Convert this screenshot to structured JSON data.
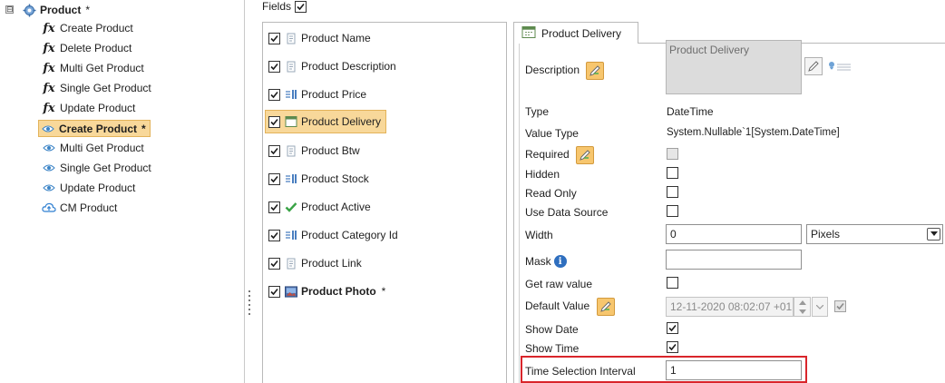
{
  "tree": {
    "root_label": "Product",
    "root_star": "*",
    "expander": "⊟",
    "items": [
      {
        "label": "Create Product",
        "icon": "fx"
      },
      {
        "label": "Delete Product",
        "icon": "fx"
      },
      {
        "label": "Multi Get Product",
        "icon": "fx"
      },
      {
        "label": "Single Get Product",
        "icon": "fx"
      },
      {
        "label": "Update Product",
        "icon": "fx"
      },
      {
        "label": "Create Product",
        "icon": "eye",
        "star": "*"
      },
      {
        "label": "Multi Get Product",
        "icon": "eye"
      },
      {
        "label": "Single Get Product",
        "icon": "eye"
      },
      {
        "label": "Update Product",
        "icon": "eye"
      },
      {
        "label": "CM Product",
        "icon": "cloud"
      }
    ]
  },
  "fields_header": {
    "label": "Fields",
    "checked": true
  },
  "fields": [
    {
      "label": "Product Name",
      "checked": true,
      "icon": "text-field-icon"
    },
    {
      "label": "Product Description",
      "checked": true,
      "icon": "text-field-icon"
    },
    {
      "label": "Product Price",
      "checked": true,
      "icon": "number-field-icon"
    },
    {
      "label": "Product Delivery",
      "checked": true,
      "icon": "calendar-icon"
    },
    {
      "label": "Product Btw",
      "checked": true,
      "icon": "text-field-icon"
    },
    {
      "label": "Product Stock",
      "checked": true,
      "icon": "number-field-icon"
    },
    {
      "label": "Product Active",
      "checked": true,
      "icon": "checkmark-icon"
    },
    {
      "label": "Product Category Id",
      "checked": true,
      "icon": "number-field-icon"
    },
    {
      "label": "Product Link",
      "checked": true,
      "icon": "text-field-icon"
    },
    {
      "label": "Product Photo",
      "checked": true,
      "icon": "image-field-icon",
      "star": "*"
    }
  ],
  "properties": {
    "tab_label": "Product Delivery",
    "description_label": "Description",
    "description_value": "Product Delivery",
    "type_label": "Type",
    "type_value": "DateTime",
    "value_type_label": "Value Type",
    "value_type_value": "System.Nullable`1[System.DateTime]",
    "required_label": "Required",
    "hidden_label": "Hidden",
    "read_only_label": "Read Only",
    "use_data_source_label": "Use Data Source",
    "width_label": "Width",
    "width_value": "0",
    "width_unit": "Pixels",
    "mask_label": "Mask",
    "mask_value": "",
    "get_raw_value_label": "Get raw value",
    "default_value_label": "Default Value",
    "default_value_value": "12-11-2020 08:02:07 +01",
    "show_date_label": "Show Date",
    "show_time_label": "Show Time",
    "time_selection_interval_label": "Time Selection Interval",
    "time_selection_interval_value": "1"
  },
  "colors": {
    "selection": "#f8d89a",
    "highlight_border": "#d9252b"
  }
}
